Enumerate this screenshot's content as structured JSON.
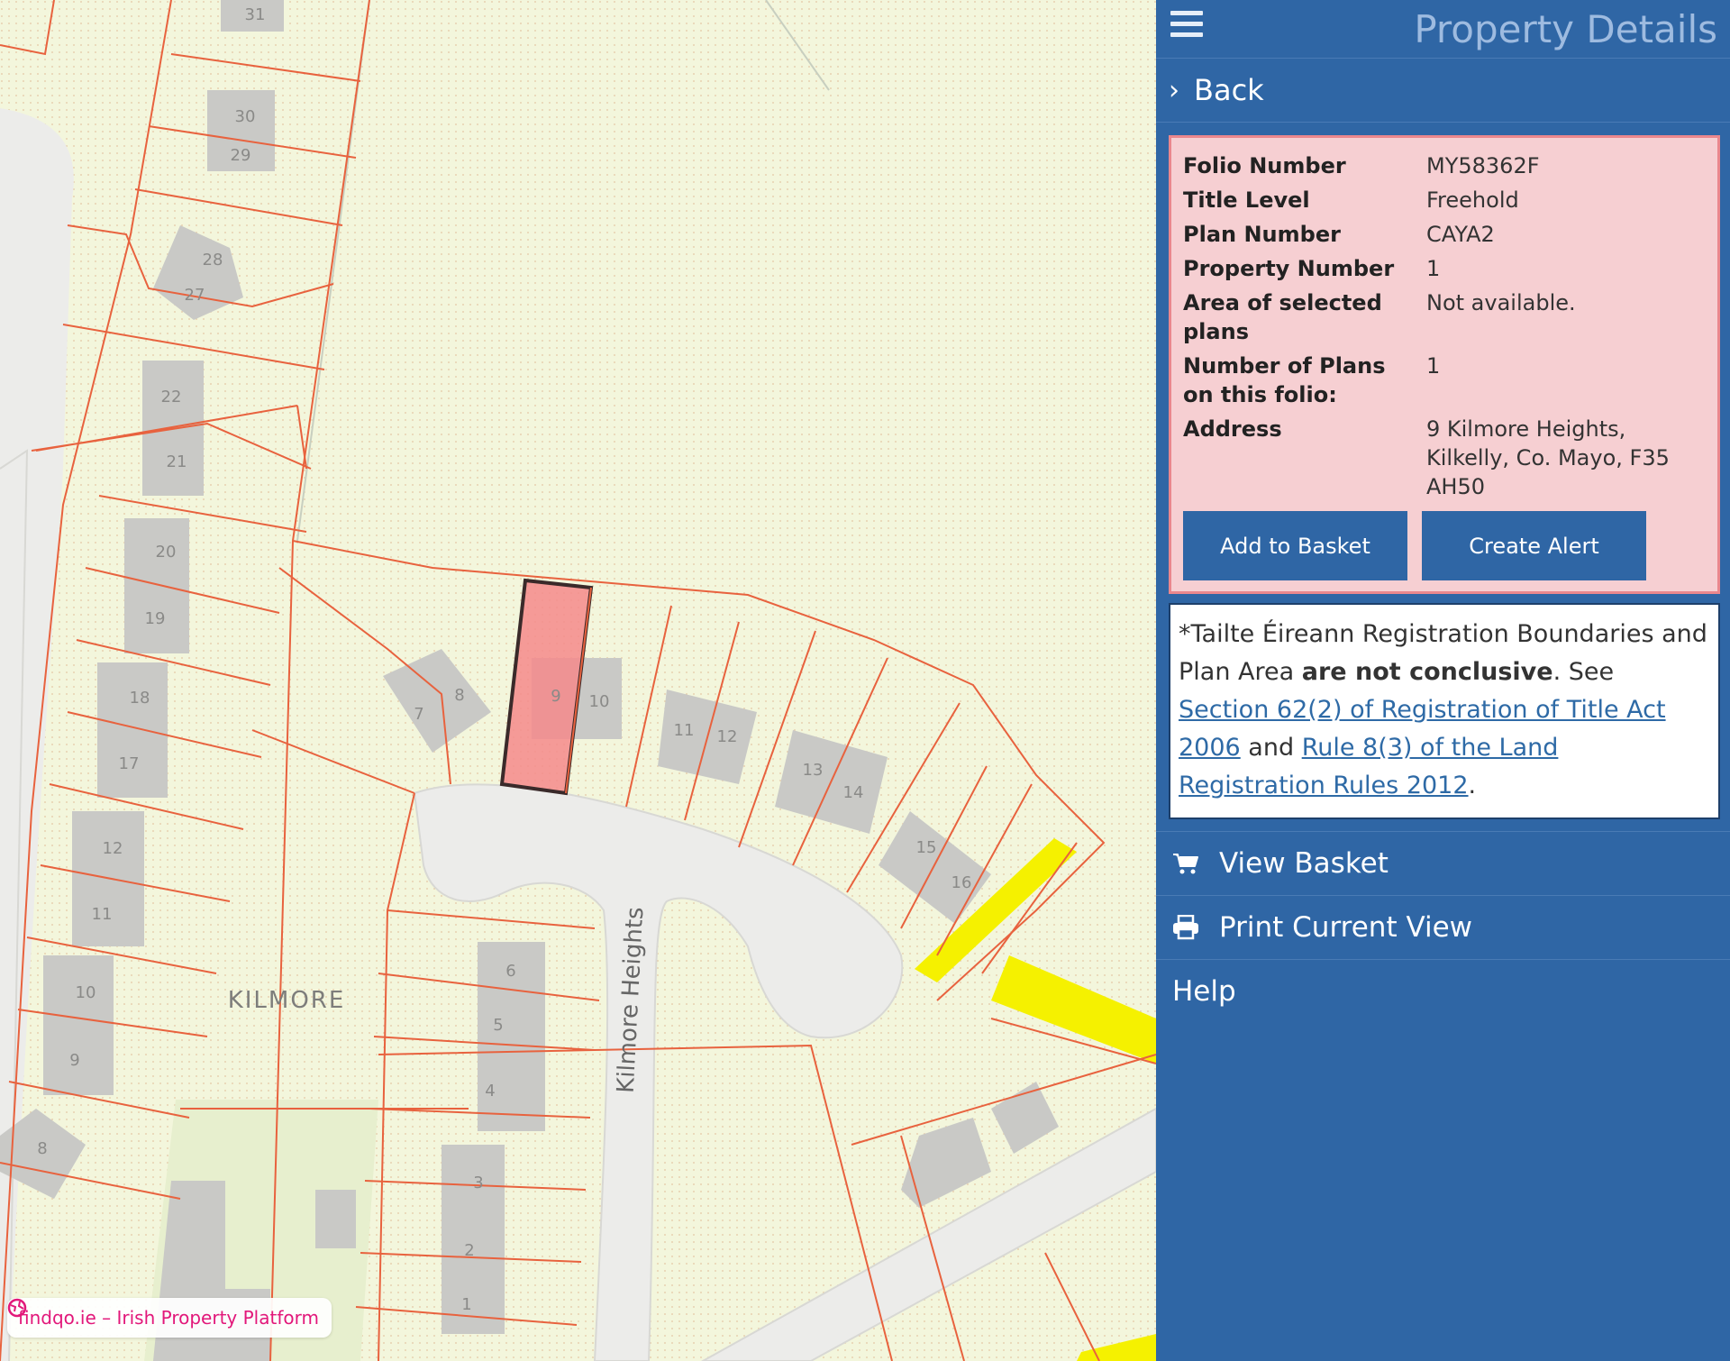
{
  "map": {
    "area_label": "KILMORE",
    "road_label": "Kilmore Heights",
    "house_numbers": [
      "31",
      "30",
      "29",
      "28",
      "27",
      "22",
      "21",
      "20",
      "19",
      "18",
      "17",
      "12",
      "11",
      "10",
      "9",
      "8",
      "7",
      "8",
      "9",
      "10",
      "11",
      "12",
      "13",
      "14",
      "15",
      "16",
      "6",
      "5",
      "4",
      "3",
      "2",
      "1"
    ],
    "colors": {
      "parcel_line": "#e8623e",
      "selected_fill": "#f4898b",
      "building": "#c9c9c6",
      "road": "#ececea",
      "highlight": "#f5f100"
    }
  },
  "watermark": {
    "text": "findqo.ie – Irish Property Platform",
    "icon": "globe-icon",
    "color": "#e2177a"
  },
  "panel": {
    "title": "Property Details",
    "menu_icon": "hamburger-icon",
    "back_label": "Back",
    "details": [
      {
        "key": "Folio Number",
        "value": "MY58362F"
      },
      {
        "key": "Title Level",
        "value": "Freehold"
      },
      {
        "key": "Plan Number",
        "value": "CAYA2"
      },
      {
        "key": "Property Number",
        "value": "1"
      },
      {
        "key": "Area of selected plans",
        "value": "Not available."
      },
      {
        "key": "Number of Plans on this folio:",
        "value": "1"
      },
      {
        "key": "Address",
        "value": "9 Kilmore Heights, Kilkelly, Co. Mayo, F35 AH50"
      }
    ],
    "add_to_basket": "Add to Basket",
    "create_alert": "Create Alert",
    "notice": {
      "part1": "*Tailte Éireann Registration Boundaries and Plan Area ",
      "bold": "are not conclusive",
      "part2": ". See ",
      "link1": "Section 62(2) of Registration of Title Act 2006",
      "part3": " and ",
      "link2": "Rule 8(3) of the Land Registration Rules 2012",
      "part4": "."
    },
    "view_basket": "View Basket",
    "print_view": "Print Current View",
    "help": "Help",
    "colors": {
      "panel_bg": "#2f66a5",
      "details_bg": "#f6cfd2",
      "details_border": "#ea878d",
      "link": "#2e6aa6"
    }
  }
}
